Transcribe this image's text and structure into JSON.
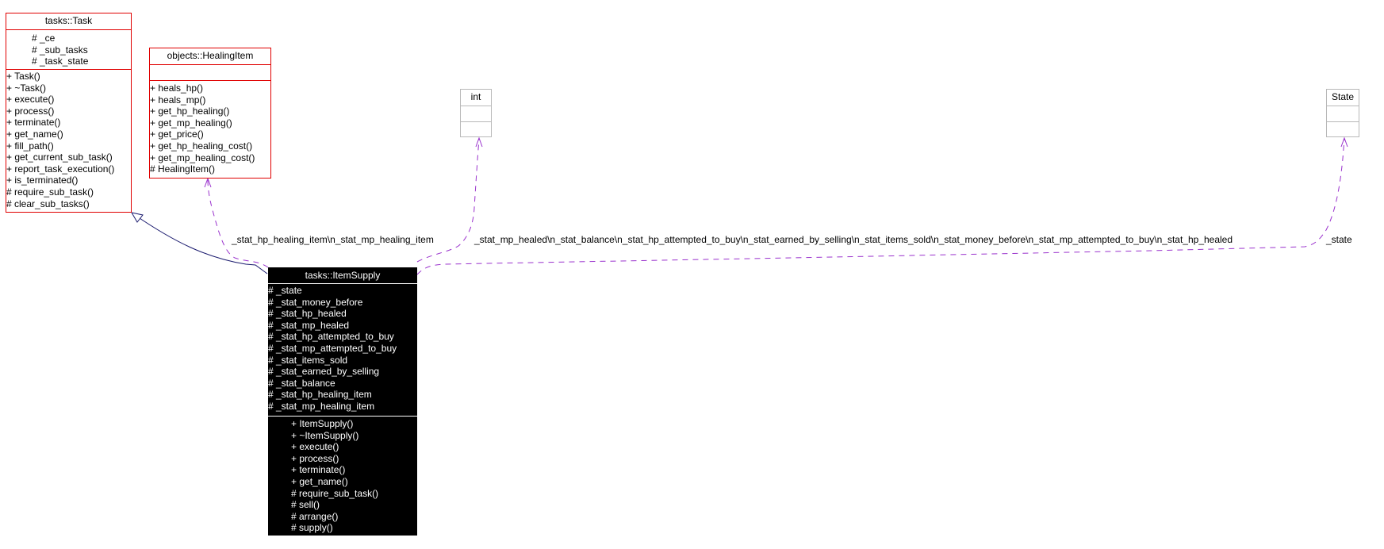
{
  "diagram": {
    "classes": {
      "task": {
        "name": "tasks::Task",
        "attributes": [
          "# _ce",
          "# _sub_tasks",
          "# _task_state"
        ],
        "methods": [
          "+ Task()",
          "+ ~Task()",
          "+ execute()",
          "+ process()",
          "+ terminate()",
          "+ get_name()",
          "+ fill_path()",
          "+ get_current_sub_task()",
          "+ report_task_execution()",
          "+ is_terminated()",
          "# require_sub_task()",
          "# clear_sub_tasks()"
        ]
      },
      "healing_item": {
        "name": "objects::HealingItem",
        "attributes": [],
        "methods": [
          "+ heals_hp()",
          "+ heals_mp()",
          "+ get_hp_healing()",
          "+ get_mp_healing()",
          "+ get_price()",
          "+ get_hp_healing_cost()",
          "+ get_mp_healing_cost()",
          "# HealingItem()"
        ]
      },
      "int": {
        "name": "int",
        "attributes": [],
        "methods": []
      },
      "state": {
        "name": "State",
        "attributes": [],
        "methods": []
      },
      "item_supply": {
        "name": "tasks::ItemSupply",
        "attributes": [
          "# _state",
          "# _stat_money_before",
          "# _stat_hp_healed",
          "# _stat_mp_healed",
          "# _stat_hp_attempted_to_buy",
          "# _stat_mp_attempted_to_buy",
          "# _stat_items_sold",
          "# _stat_earned_by_selling",
          "# _stat_balance",
          "# _stat_hp_healing_item",
          "# _stat_mp_healing_item"
        ],
        "methods": [
          "+ ItemSupply()",
          "+ ~ItemSupply()",
          "+ execute()",
          "+ process()",
          "+ terminate()",
          "+ get_name()",
          "# require_sub_task()",
          "# sell()",
          "# arrange()",
          "# supply()"
        ]
      }
    },
    "edges": [
      {
        "type": "inheritance",
        "from": "tasks::ItemSupply",
        "to": "tasks::Task",
        "label": ""
      },
      {
        "type": "usage",
        "from": "tasks::ItemSupply",
        "to": "objects::HealingItem",
        "label": "_stat_hp_healing_item\\n_stat_mp_healing_item"
      },
      {
        "type": "usage",
        "from": "tasks::ItemSupply",
        "to": "int",
        "label": "_stat_mp_healed\\n_stat_balance\\n_stat_hp_attempted_to_buy\\n_stat_earned_by_selling\\n_stat_items_sold\\n_stat_money_before\\n_stat_mp_attempted_to_buy\\n_stat_hp_healed"
      },
      {
        "type": "usage",
        "from": "tasks::ItemSupply",
        "to": "State",
        "label": "_state"
      }
    ],
    "colors": {
      "class_border": "#e00000",
      "primitive_border": "#b8b8b8",
      "inheritance_edge": "#1a1a6e",
      "usage_edge": "#9a32cd",
      "focus_class_bg": "#000000"
    }
  }
}
